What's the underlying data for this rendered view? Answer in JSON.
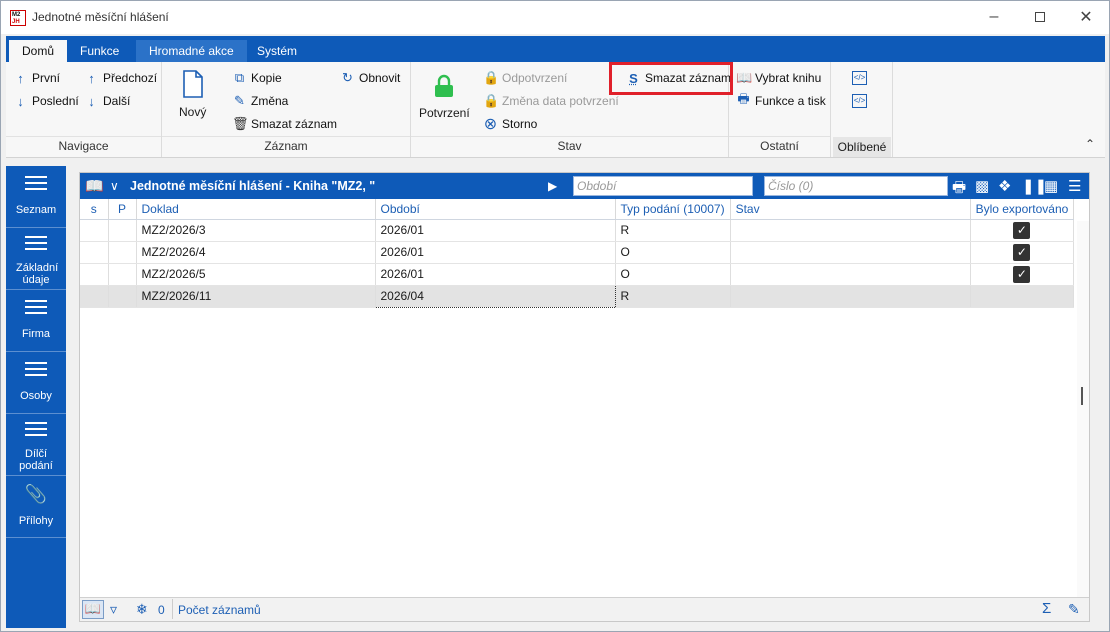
{
  "window": {
    "title": "Jednotné měsíční hlášení",
    "logo_text": "M2",
    "logo_sub": "JH"
  },
  "ribbon_tabs": [
    {
      "label": "Domů"
    },
    {
      "label": "Funkce"
    },
    {
      "label": "Hromadné akce"
    },
    {
      "label": "Systém"
    }
  ],
  "ribbon": {
    "navigace": {
      "first": "První",
      "prev": "Předchozí",
      "last": "Poslední",
      "next": "Další",
      "label": "Navigace"
    },
    "zaznam": {
      "new": "Nový",
      "copy": "Kopie",
      "change": "Změna",
      "delete": "Smazat záznam",
      "refresh": "Obnovit",
      "label": "Záznam"
    },
    "stav": {
      "confirm": "Potvrzení",
      "unconfirm": "Odpotvrzení",
      "change_date": "Změna data potvrzení",
      "storno": "Storno",
      "delete_s": "Smazat záznam",
      "label": "Stav"
    },
    "ostatni": {
      "select_book": "Vybrat knihu",
      "functions_print": "Funkce a tisk",
      "label": "Ostatní"
    },
    "oblibene": {
      "label": "Oblíbené"
    }
  },
  "sidebar": [
    {
      "label": "Seznam"
    },
    {
      "label": "Základní údaje"
    },
    {
      "label": "Firma"
    },
    {
      "label": "Osoby"
    },
    {
      "label": "Dílčí podání"
    },
    {
      "label": "Přílohy"
    }
  ],
  "toolbar": {
    "title": "Jednotné měsíční hlášení - Kniha \"MZ2, \"",
    "period_placeholder": "Období",
    "number_placeholder": "Číslo (0)"
  },
  "grid": {
    "columns": [
      "s",
      "P",
      "Doklad",
      "Období",
      "Typ podání (10007)",
      "Stav",
      "Bylo exportováno"
    ],
    "rows": [
      {
        "doklad": "MZ2/2026/3",
        "obdobi": "2026/01",
        "typ": "R",
        "stav": "",
        "exported": true
      },
      {
        "doklad": "MZ2/2026/4",
        "obdobi": "2026/01",
        "typ": "O",
        "stav": "",
        "exported": true
      },
      {
        "doklad": "MZ2/2026/5",
        "obdobi": "2026/01",
        "typ": "O",
        "stav": "",
        "exported": true
      },
      {
        "doklad": "MZ2/2026/11",
        "obdobi": "2026/04",
        "typ": "R",
        "stav": "",
        "exported": false
      }
    ]
  },
  "status": {
    "count": "0",
    "count_label": "Počet záznamů"
  },
  "colors": {
    "accent": "#0e5ab8",
    "highlight_box": "#e0202a"
  }
}
